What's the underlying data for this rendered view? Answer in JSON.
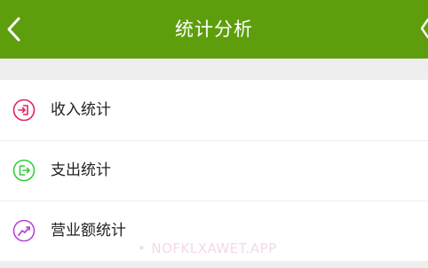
{
  "header": {
    "title": "统计分析",
    "back_icon": "chevron-left-icon",
    "background_color": "#5e9e0c"
  },
  "menu": {
    "items": [
      {
        "label": "收入统计",
        "icon": "login-arrow-icon",
        "icon_color": "#e0245e"
      },
      {
        "label": "支出统计",
        "icon": "logout-arrow-icon",
        "icon_color": "#2fcf3a"
      },
      {
        "label": "营业额统计",
        "icon": "chart-icon",
        "icon_color": "#b845d6"
      }
    ]
  },
  "watermark": {
    "dot": "•",
    "text": "NOFKLXAWET.APP"
  }
}
